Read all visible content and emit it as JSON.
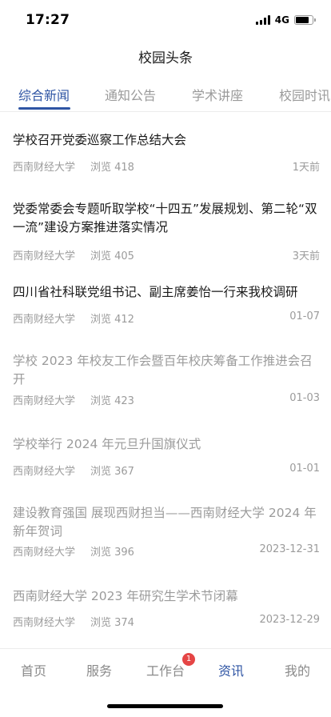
{
  "status_bar": {
    "time": "17:27",
    "network": "4G"
  },
  "nav": {
    "title": "校园头条"
  },
  "tabs": [
    {
      "label": "综合新闻",
      "active": true
    },
    {
      "label": "通知公告",
      "active": false
    },
    {
      "label": "学术讲座",
      "active": false
    },
    {
      "label": "校园时讯",
      "active": false
    }
  ],
  "news": [
    {
      "title": "学校召开党委巡察工作总结大会",
      "source": "西南财经大学",
      "views": "浏览 418",
      "date": "1天前",
      "read": false
    },
    {
      "title": "党委常委会专题听取学校“十四五”发展规划、第二轮“双一流”建设方案推进落实情况",
      "source": "西南财经大学",
      "views": "浏览 405",
      "date": "3天前",
      "read": false
    },
    {
      "title": "四川省社科联党组书记、副主席姜怡一行来我校调研",
      "source": "西南财经大学",
      "views": "浏览 412",
      "date": "01-07",
      "read": false
    },
    {
      "title": "学校 2023 年校友工作会暨百年校庆筹备工作推进会召开",
      "source": "西南财经大学",
      "views": "浏览 423",
      "date": "01-03",
      "read": true
    },
    {
      "title": "学校举行 2024 年元旦升国旗仪式",
      "source": "西南财经大学",
      "views": "浏览 367",
      "date": "01-01",
      "read": true
    },
    {
      "title": "建设教育强国 展现西财担当——西南财经大学 2024 年新年贺词",
      "source": "西南财经大学",
      "views": "浏览 396",
      "date": "2023-12-31",
      "read": true
    },
    {
      "title": "西南财经大学 2023 年研究生学术节闭幕",
      "source": "西南财经大学",
      "views": "浏览 374",
      "date": "2023-12-29",
      "read": true
    }
  ],
  "tabbar": {
    "items": [
      {
        "label": "首页",
        "active": false
      },
      {
        "label": "服务",
        "active": false
      },
      {
        "label": "工作台",
        "active": false
      },
      {
        "label": "资讯",
        "active": true
      },
      {
        "label": "我的",
        "active": false
      }
    ],
    "badge": "1"
  },
  "colors": {
    "accent": "#2f55a4",
    "badge": "#e54545",
    "read_text": "#9b9b9b"
  }
}
